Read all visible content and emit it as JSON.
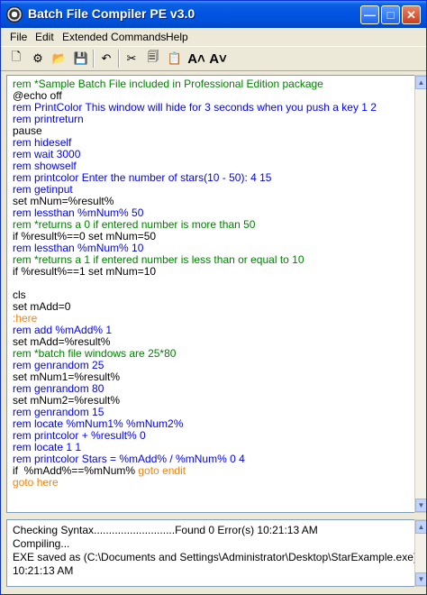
{
  "window": {
    "title": "Batch File Compiler PE v3.0"
  },
  "title_buttons": {
    "minimize": "—",
    "maximize": "□",
    "close": "✕"
  },
  "menu": [
    "File",
    "Edit",
    "Extended Commands",
    "Help"
  ],
  "toolbar": [
    {
      "name": "new-icon",
      "glyph": "🗋"
    },
    {
      "name": "compile-icon",
      "glyph": "⚙"
    },
    {
      "name": "open-icon",
      "glyph": "📂"
    },
    {
      "name": "save-icon",
      "glyph": "💾"
    },
    {
      "name": "undo-icon",
      "glyph": "↶"
    },
    {
      "name": "cut-icon",
      "glyph": "✂"
    },
    {
      "name": "copy-icon",
      "glyph": "🗐"
    },
    {
      "name": "paste-icon",
      "glyph": "📋"
    },
    {
      "name": "font-increase-icon",
      "glyph": "A˄"
    },
    {
      "name": "font-decrease-icon",
      "glyph": "A˅"
    }
  ],
  "colors": {
    "comment": "#008000",
    "command": "#0000ff",
    "plain": "#000000",
    "label": "#ff8000"
  },
  "code_lines": [
    {
      "t": "rem *Sample Batch File included in Professional Edition package",
      "c": "comment"
    },
    {
      "t": "@echo off",
      "c": "plain"
    },
    {
      "t": "rem PrintColor This window will hide for 3 seconds when you push a key 1 2",
      "c": "command"
    },
    {
      "t": "rem printreturn",
      "c": "command"
    },
    {
      "t": "pause",
      "c": "plain"
    },
    {
      "t": "rem hideself",
      "c": "command"
    },
    {
      "t": "rem wait 3000",
      "c": "command"
    },
    {
      "t": "rem showself",
      "c": "command"
    },
    {
      "t": "rem printcolor Enter the number of stars(10 - 50): 4 15",
      "c": "command"
    },
    {
      "t": "rem getinput",
      "c": "command"
    },
    {
      "t": "set mNum=%result%",
      "c": "plain"
    },
    {
      "t": "rem lessthan %mNum% 50",
      "c": "command"
    },
    {
      "t": "rem *returns a 0 if entered number is more than 50",
      "c": "comment"
    },
    {
      "t": "if %result%==0 set mNum=50",
      "c": "plain"
    },
    {
      "t": "rem lessthan %mNum% 10",
      "c": "command"
    },
    {
      "t": "rem *returns a 1 if entered number is less than or equal to 10",
      "c": "comment"
    },
    {
      "t": "if %result%==1 set mNum=10",
      "c": "plain"
    },
    {
      "t": "",
      "c": "plain"
    },
    {
      "t": "cls",
      "c": "plain"
    },
    {
      "t": "set mAdd=0",
      "c": "plain"
    },
    {
      "t": ":here",
      "c": "label"
    },
    {
      "t": "rem add %mAdd% 1",
      "c": "command"
    },
    {
      "t": "set mAdd=%result%",
      "c": "plain"
    },
    {
      "t": "rem *batch file windows are 25*80",
      "c": "comment"
    },
    {
      "t": "rem genrandom 25",
      "c": "command"
    },
    {
      "t": "set mNum1=%result%",
      "c": "plain"
    },
    {
      "t": "rem genrandom 80",
      "c": "command"
    },
    {
      "t": "set mNum2=%result%",
      "c": "plain"
    },
    {
      "t": "rem genrandom 15",
      "c": "command"
    },
    {
      "t": "rem locate %mNum1% %mNum2%",
      "c": "command"
    },
    {
      "t": "rem printcolor + %result% 0",
      "c": "command"
    },
    {
      "t": "rem locate 1 1",
      "c": "command"
    },
    {
      "t": "rem printcolor Stars = %mAdd% / %mNum% 0 4",
      "c": "command"
    },
    {
      "parts": [
        {
          "t": "if  %mAdd%==%mNum% ",
          "c": "plain"
        },
        {
          "t": "goto endit",
          "c": "label"
        }
      ]
    },
    {
      "t": "goto here",
      "c": "label"
    }
  ],
  "output_lines": [
    "Checking Syntax...........................Found 0 Error(s) 10:21:13 AM",
    "Compiling...",
    "EXE saved as (C:\\Documents and Settings\\Administrator\\Desktop\\StarExample.exe)",
    "10:21:13 AM"
  ]
}
